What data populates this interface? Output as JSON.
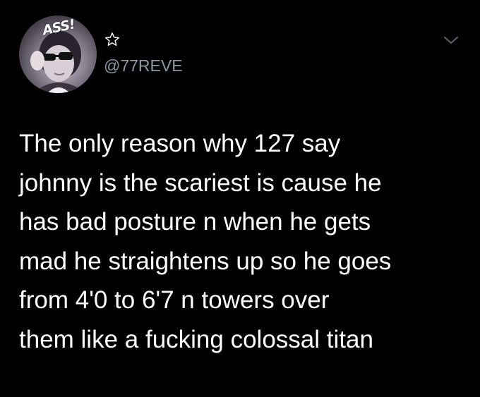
{
  "tweet": {
    "avatar": {
      "stamp_text": "ASS!",
      "icon": "user-avatar-photo"
    },
    "display_name_icon": "star-outline-icon",
    "handle": "@77REVE",
    "menu_icon": "chevron-down-icon",
    "text_lines": [
      "The only reason why 127 say",
      "johnny is the scariest is cause he",
      "has bad posture n when he gets",
      "mad he straightens up so he goes",
      "from 4'0 to 6'7 n towers over",
      "them like a fucking colossal titan"
    ]
  },
  "colors": {
    "background": "#000000",
    "text": "#ffffff",
    "secondary_text": "#8b98a5"
  }
}
